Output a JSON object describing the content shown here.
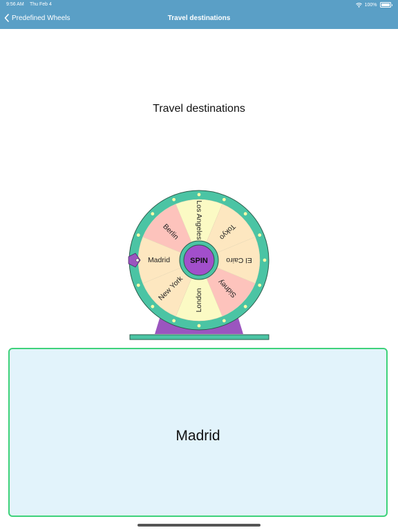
{
  "status_bar": {
    "time": "9:56 AM",
    "date": "Thu Feb 4",
    "battery": "100%"
  },
  "nav": {
    "back_label": "Predefined Wheels",
    "title": "Travel destinations"
  },
  "wheel": {
    "title": "Travel destinations",
    "spin_label": "SPIN",
    "segments": [
      {
        "label": "Los Angeles",
        "color": "#fbfac4"
      },
      {
        "label": "Tokyo",
        "color": "#fde7c0"
      },
      {
        "label": "El Cairo",
        "color": "#fde7c0"
      },
      {
        "label": "Sidney",
        "color": "#fdc3bc"
      },
      {
        "label": "London",
        "color": "#fbfac4"
      },
      {
        "label": "New York",
        "color": "#fde7c0"
      },
      {
        "label": "Madrid",
        "color": "#fde7c0"
      },
      {
        "label": "Berlin",
        "color": "#fdc3bc"
      }
    ],
    "rim_color": "#4bc4a4",
    "stand_color": "#9b55bf",
    "hub_color": "#a24fcb",
    "pointer_color": "#9b55bf",
    "light_color": "#fffaa8"
  },
  "result": {
    "value": "Madrid"
  }
}
